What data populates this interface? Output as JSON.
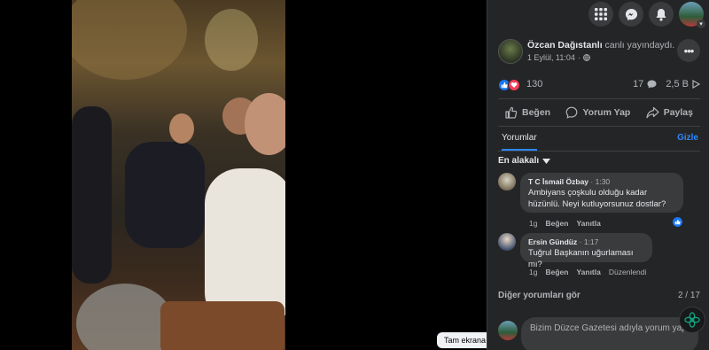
{
  "video": {
    "fullscreen_tooltip": "Tam ekrana geç"
  },
  "post": {
    "author": "Özcan Dağıstanlı",
    "action": "canlı yayındaydı.",
    "timestamp": "1 Eylül, 11:04",
    "privacy_icon": "globe-icon"
  },
  "reactions": {
    "count": "130",
    "comments_count": "17",
    "views": "2,5 B"
  },
  "actions": {
    "like": "Beğen",
    "comment": "Yorum Yap",
    "share": "Paylaş"
  },
  "comments_section": {
    "tab": "Yorumlar",
    "hide": "Gizle",
    "sort": "En alakalı"
  },
  "comments": [
    {
      "author": "T C İsmail Özbay",
      "time": "1:30",
      "text_line1": "Ambiyans çoşkulu olduğu kadar",
      "text_line2": "hüzünlü. Neyi kutluyorsunuz dostlar?",
      "age": "1g",
      "like": "Beğen",
      "reply": "Yanıtla"
    },
    {
      "author": "Ersin Gündüz",
      "time": "1:17",
      "text_line1": "Tuğrul Başkanın uğurlaması mı?",
      "age": "1g",
      "like": "Beğen",
      "reply": "Yanıtla",
      "edited": "Düzenlendi"
    }
  ],
  "more_comments": {
    "label": "Diğer yorumları gör",
    "count": "2 / 17"
  },
  "composer": {
    "placeholder": "Bizim Düzce Gazetesi adıyla yorum yap"
  },
  "colors": {
    "accent": "#2d88ff",
    "like": "#1877f2",
    "love": "#f33e58",
    "panel_bg": "#242526"
  }
}
